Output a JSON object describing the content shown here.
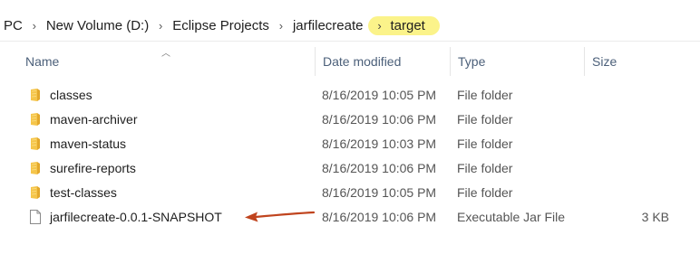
{
  "breadcrumb": {
    "items": [
      "PC",
      "New Volume (D:)",
      "Eclipse Projects",
      "jarfilecreate"
    ],
    "current": "target",
    "separator": "›"
  },
  "columns": {
    "name": "Name",
    "date": "Date modified",
    "type": "Type",
    "size": "Size"
  },
  "files": [
    {
      "name": "classes",
      "date": "8/16/2019 10:05 PM",
      "type": "File folder",
      "size": "",
      "icon": "folder-icon"
    },
    {
      "name": "maven-archiver",
      "date": "8/16/2019 10:06 PM",
      "type": "File folder",
      "size": "",
      "icon": "folder-icon"
    },
    {
      "name": "maven-status",
      "date": "8/16/2019 10:03 PM",
      "type": "File folder",
      "size": "",
      "icon": "folder-icon"
    },
    {
      "name": "surefire-reports",
      "date": "8/16/2019 10:06 PM",
      "type": "File folder",
      "size": "",
      "icon": "folder-icon"
    },
    {
      "name": "test-classes",
      "date": "8/16/2019 10:05 PM",
      "type": "File folder",
      "size": "",
      "icon": "folder-icon"
    },
    {
      "name": "jarfilecreate-0.0.1-SNAPSHOT",
      "date": "8/16/2019 10:06 PM",
      "type": "Executable Jar File",
      "size": "3 KB",
      "icon": "file-icon"
    }
  ],
  "colors": {
    "highlight": "#fbf38a",
    "folder": "#f5c54a",
    "arrow": "#c0441e",
    "header_text": "#4c607a"
  }
}
